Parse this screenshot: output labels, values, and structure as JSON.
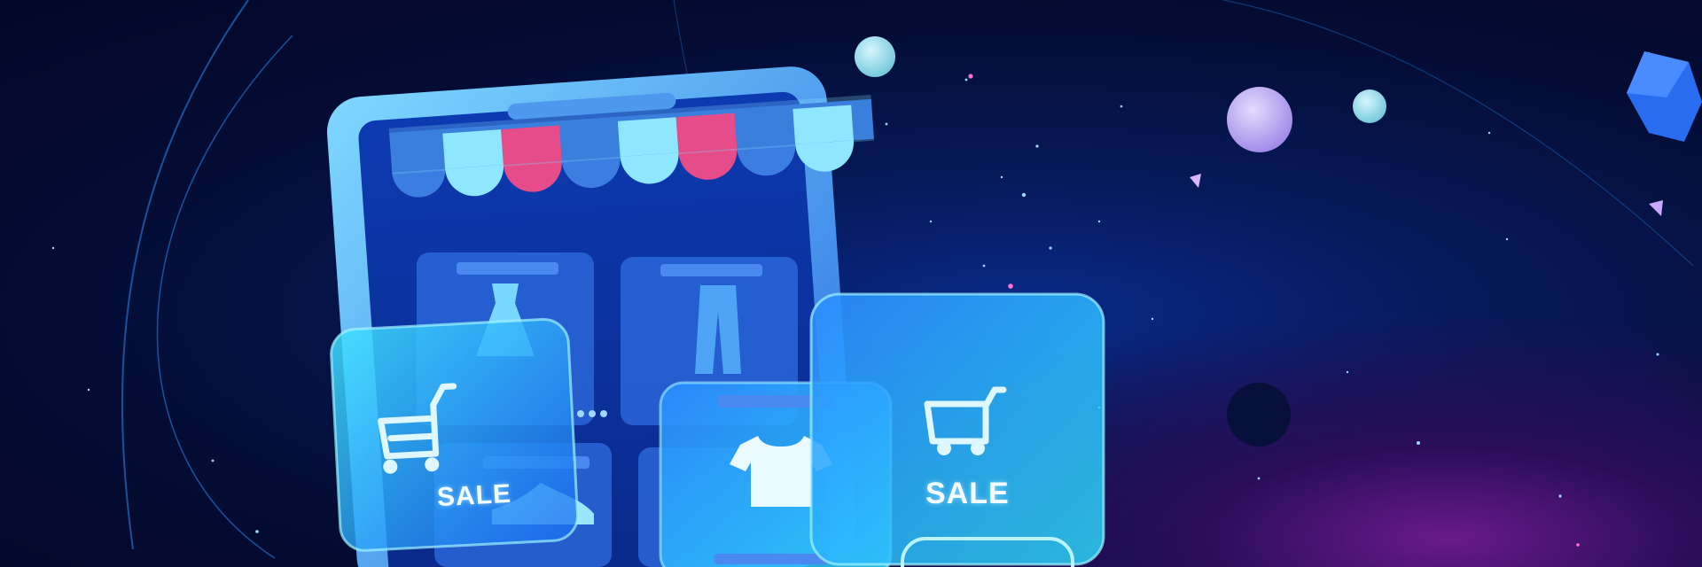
{
  "scene": {
    "description_labels": {
      "left_card_text": "SALE",
      "right_card_text": "SALE"
    },
    "colors": {
      "background": "#050a2a",
      "glass_cyan": "#4fd8ff",
      "awning_pink": "#e64b8a",
      "awning_light": "#8ee6ff",
      "awning_blue": "#3b7de0",
      "planet_violet": "#b7a6f0",
      "planet_teal": "#8fd8e8"
    },
    "icons": [
      "storefront-awning",
      "dress-icon",
      "pants-icon",
      "tshirt-icon",
      "sneaker-icon",
      "shopping-cart-icon",
      "shopping-cart-icon"
    ]
  }
}
